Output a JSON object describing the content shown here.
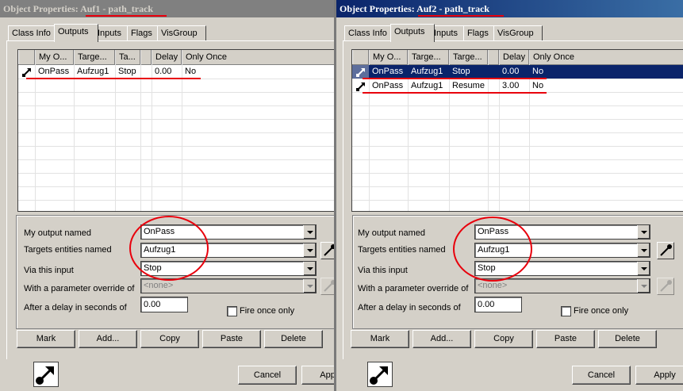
{
  "left": {
    "title": "Object Properties: Auf1 - path_track",
    "tabs": [
      "Class Info",
      "Outputs",
      "Inputs",
      "Flags",
      "VisGroup"
    ],
    "columns": [
      "My O...",
      "Targe...",
      "Ta...",
      "Delay",
      "Only Once"
    ],
    "rows": [
      {
        "output": "OnPass",
        "target": "Aufzug1",
        "input": "Stop",
        "delay": "0.00",
        "once": "No",
        "selected": false
      }
    ],
    "form": {
      "output_label": "My output named",
      "output_value": "OnPass",
      "targets_label": "Targets entities named",
      "targets_value": "Aufzug1",
      "input_label": "Via this input",
      "input_value": "Stop",
      "param_label": "With a parameter override of",
      "param_value": "<none>",
      "delay_label": "After a delay in seconds of",
      "delay_value": "0.00",
      "fire_once_label": "Fire once only"
    },
    "buttons": {
      "mark": "Mark",
      "add": "Add...",
      "copy": "Copy",
      "paste": "Paste",
      "delete": "Delete"
    },
    "footer": {
      "cancel": "Cancel",
      "apply": "Apply"
    }
  },
  "right": {
    "title": "Object Properties: Auf2 - path_track",
    "tabs": [
      "Class Info",
      "Outputs",
      "Inputs",
      "Flags",
      "VisGroup"
    ],
    "columns": [
      "My O...",
      "Targe...",
      "Targe...",
      "Delay",
      "Only Once"
    ],
    "rows": [
      {
        "output": "OnPass",
        "target": "Aufzug1",
        "input": "Stop",
        "delay": "0.00",
        "once": "No",
        "selected": true
      },
      {
        "output": "OnPass",
        "target": "Aufzug1",
        "input": "Resume",
        "delay": "3.00",
        "once": "No",
        "selected": false
      }
    ],
    "form": {
      "output_label": "My output named",
      "output_value": "OnPass",
      "targets_label": "Targets entities named",
      "targets_value": "Aufzug1",
      "input_label": "Via this input",
      "input_value": "Stop",
      "param_label": "With a parameter override of",
      "param_value": "<none>",
      "delay_label": "After a delay in seconds of",
      "delay_value": "0.00",
      "fire_once_label": "Fire once only"
    },
    "buttons": {
      "mark": "Mark",
      "add": "Add...",
      "copy": "Copy",
      "paste": "Paste",
      "delete": "Delete"
    },
    "footer": {
      "cancel": "Cancel",
      "apply": "Apply"
    }
  },
  "colors": {
    "highlight": "#0a246a",
    "annotation": "#e8000c",
    "face": "#d4d0c8"
  },
  "icons": {
    "output": "output-arrow-icon",
    "eyedropper": "eyedropper-icon"
  }
}
